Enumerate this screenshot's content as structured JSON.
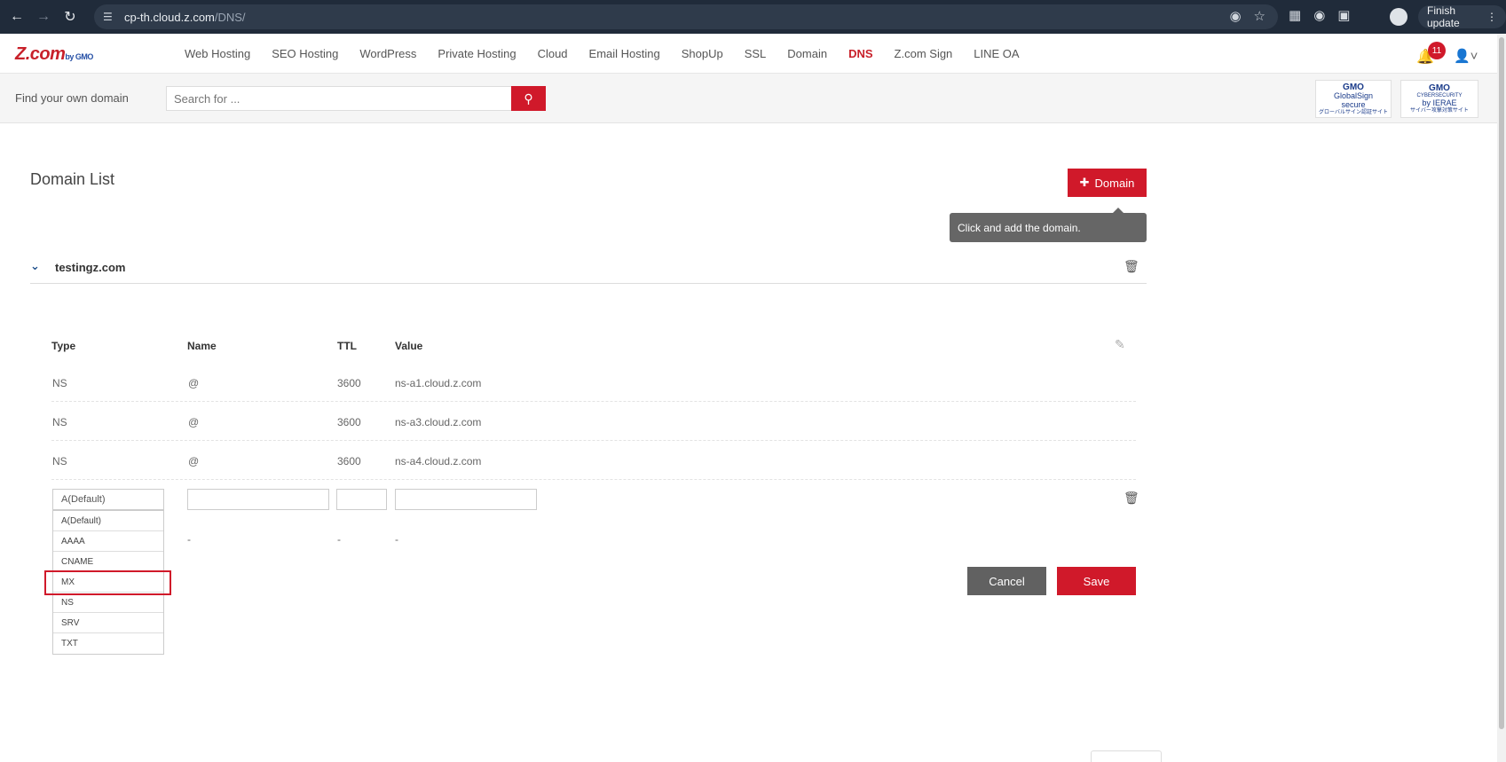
{
  "browser": {
    "url_host": "cp-th.cloud.z.com",
    "url_path": "/DNS/",
    "finish_update": "Finish update",
    "icons": [
      "back-icon",
      "forward-icon",
      "reload-icon",
      "tune-icon",
      "eye-off-icon",
      "star-icon",
      "translate-icon",
      "extension-icon",
      "puzzle-icon",
      "profile-icon",
      "kebab-icon"
    ]
  },
  "header": {
    "logo_main": "Z.com",
    "logo_sub": "by GMO",
    "nav": [
      "Web Hosting",
      "SEO Hosting",
      "WordPress",
      "Private Hosting",
      "Cloud",
      "Email Hosting",
      "ShopUp",
      "SSL",
      "Domain",
      "DNS",
      "Z.com Sign",
      "LINE OA"
    ],
    "active_nav": "DNS",
    "notification_count": "11"
  },
  "search": {
    "label": "Find your own domain",
    "placeholder": "Search for ..."
  },
  "seals": {
    "seal1_top": "GMO",
    "seal1_mid": "GlobalSign",
    "seal1_bot": "secure",
    "seal1_jp": "グローバルサイン認証サイト",
    "seal2_top": "GMO",
    "seal2_mid": "CYBERSECURITY",
    "seal2_bot": "by IERAE",
    "seal2_jp": "サイバー攻撃対策サイト"
  },
  "content": {
    "title": "Domain List",
    "add_domain_label": "Domain",
    "tooltip": "Click and add the domain.",
    "domain_name": "testingz.com"
  },
  "table": {
    "headers": {
      "type": "Type",
      "name": "Name",
      "ttl": "TTL",
      "value": "Value"
    },
    "rows": [
      {
        "type": "NS",
        "name": "@",
        "ttl": "3600",
        "value": "ns-a1.cloud.z.com"
      },
      {
        "type": "NS",
        "name": "@",
        "ttl": "3600",
        "value": "ns-a3.cloud.z.com"
      },
      {
        "type": "NS",
        "name": "@",
        "ttl": "3600",
        "value": "ns-a4.cloud.z.com"
      }
    ],
    "new_row": {
      "selected_type": "A(Default)",
      "placeholder_name": "-",
      "placeholder_ttl": "-",
      "placeholder_value": "-"
    },
    "type_options": [
      "A(Default)",
      "AAAA",
      "CNAME",
      "MX",
      "NS",
      "SRV",
      "TXT"
    ],
    "highlighted_option": "MX"
  },
  "actions": {
    "cancel": "Cancel",
    "save": "Save"
  },
  "colors": {
    "brand_red": "#d0192a",
    "chrome_bg": "#202b3a",
    "cancel_gray": "#616161"
  }
}
